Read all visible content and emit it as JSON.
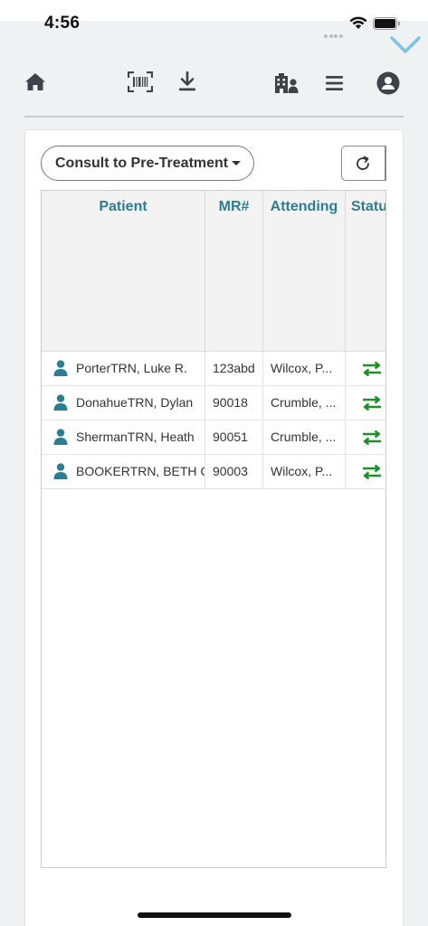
{
  "status_bar": {
    "time": "4:56"
  },
  "toolbar": {
    "icons": [
      "home-icon",
      "barcode-scan-icon",
      "download-icon",
      "building-user-icon",
      "menu-icon",
      "user-profile-icon"
    ]
  },
  "filter": {
    "selected": "Consult to Pre-Treatment"
  },
  "table": {
    "columns": [
      "Patient",
      "MR#",
      "Attending",
      "Status"
    ],
    "rows": [
      {
        "patient": "PorterTRN, Luke R.",
        "mr": "123abd",
        "attending": "Wilcox, P..."
      },
      {
        "patient": "DonahueTRN, Dylan",
        "mr": "90018",
        "attending": "Crumble, ..."
      },
      {
        "patient": "ShermanTRN, Heath",
        "mr": "90051",
        "attending": "Crumble, ..."
      },
      {
        "patient": "BOOKERTRN, BETH C.",
        "mr": "90003",
        "attending": "Wilcox, P..."
      }
    ]
  },
  "colors": {
    "accent": "#2c7d93",
    "status_green": "#1f8f2a",
    "icon_dark": "#3d4348",
    "chevron": "#7cc3e6"
  }
}
